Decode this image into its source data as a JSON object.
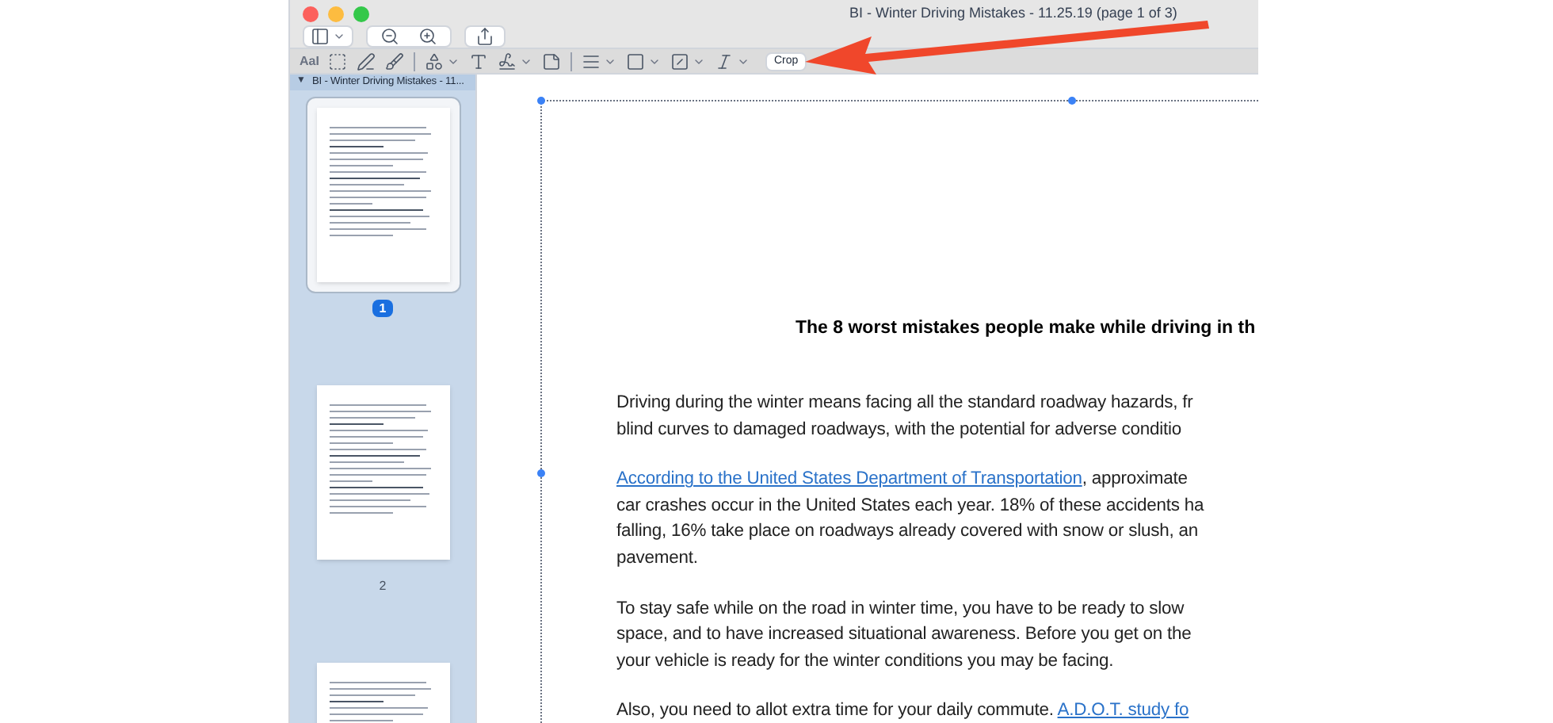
{
  "window": {
    "title": "BI - Winter Driving Mistakes - 11.25.19 (page 1 of 3)"
  },
  "markup_toolbar": {
    "text_tool": "AaI",
    "crop_button": "Crop"
  },
  "sidebar": {
    "toggle": "▼",
    "header": "BI - Winter Driving Mistakes - 11...",
    "expanded": true,
    "pages": [
      {
        "label": "1",
        "selected": true
      },
      {
        "label": "2",
        "selected": false
      },
      {
        "selected": false
      }
    ]
  },
  "document": {
    "title": "The 8 worst mistakes people make while driving in th",
    "paragraphs": [
      {
        "lines": [
          [
            {
              "kind": "text",
              "text": "Driving during the winter means facing all the standard roadway hazards, fr"
            }
          ],
          [
            {
              "kind": "text",
              "text": "blind curves to damaged roadways, with the potential for adverse conditio"
            }
          ]
        ]
      },
      {
        "lines": [
          [
            {
              "kind": "link",
              "text": "According to the United States Department of Transportation"
            },
            {
              "kind": "text",
              "text": ", approximate"
            }
          ],
          [
            {
              "kind": "text",
              "text": "car crashes occur in the United States each year. 18% of these accidents ha"
            }
          ],
          [
            {
              "kind": "text",
              "text": "falling, 16% take place on roadways already covered with snow or slush, an"
            }
          ],
          [
            {
              "kind": "text",
              "text": "pavement."
            }
          ]
        ]
      },
      {
        "lines": [
          [
            {
              "kind": "text",
              "text": "To stay safe while on the road in winter time, you have to be ready to slow"
            }
          ],
          [
            {
              "kind": "text",
              "text": "space, and to have increased situational awareness. Before you get on the"
            }
          ],
          [
            {
              "kind": "text",
              "text": "your vehicle is ready for the winter conditions you may be facing."
            }
          ]
        ]
      },
      {
        "lines": [
          [
            {
              "kind": "text",
              "text": "Also, you need to allot extra time for your daily commute. "
            },
            {
              "kind": "link",
              "text": "A.D.O.T. study fo"
            }
          ]
        ]
      }
    ]
  }
}
